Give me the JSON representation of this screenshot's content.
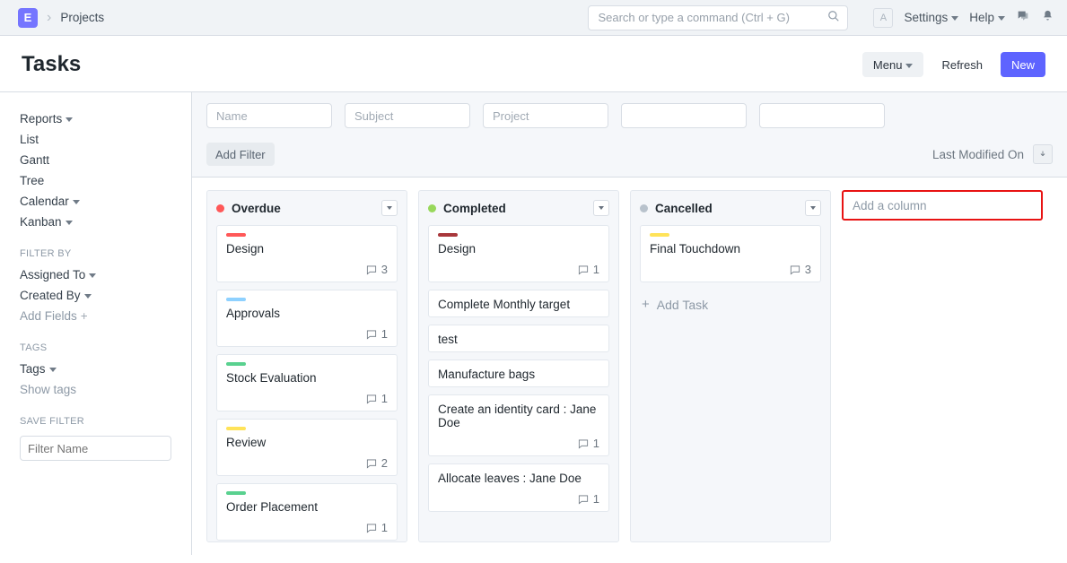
{
  "nav": {
    "logo_letter": "E",
    "breadcrumb": "Projects",
    "search_placeholder": "Search or type a command (Ctrl + G)",
    "avatar_letter": "A",
    "settings_label": "Settings",
    "help_label": "Help"
  },
  "page": {
    "title": "Tasks",
    "menu_btn": "Menu",
    "refresh_btn": "Refresh",
    "new_btn": "New"
  },
  "sidebar": {
    "views": [
      {
        "label": "Reports",
        "caret": true
      },
      {
        "label": "List",
        "caret": false
      },
      {
        "label": "Gantt",
        "caret": false
      },
      {
        "label": "Tree",
        "caret": false
      },
      {
        "label": "Calendar",
        "caret": true
      },
      {
        "label": "Kanban",
        "caret": true
      }
    ],
    "filter_by_label": "FILTER BY",
    "filter_by": [
      {
        "label": "Assigned To",
        "caret": true
      },
      {
        "label": "Created By",
        "caret": true
      }
    ],
    "add_fields_label": "Add Fields",
    "tags_label": "TAGS",
    "tags_link": "Tags",
    "show_tags": "Show tags",
    "save_filter_label": "SAVE FILTER",
    "filter_name_placeholder": "Filter Name"
  },
  "filter_bar": {
    "inputs": [
      {
        "placeholder": "Name"
      },
      {
        "placeholder": "Subject"
      },
      {
        "placeholder": "Project"
      },
      {
        "placeholder": ""
      },
      {
        "placeholder": ""
      }
    ],
    "add_filter": "Add Filter",
    "sort_label": "Last Modified On"
  },
  "board": {
    "add_col_label": "Add a column",
    "add_task_label": "Add Task",
    "columns": [
      {
        "title": "Overdue",
        "color": "#ff5858",
        "cards": [
          {
            "title": "Design",
            "bar": "#ff5858",
            "comments": 3
          },
          {
            "title": "Approvals",
            "bar": "#8ed1ff",
            "comments": 1
          },
          {
            "title": "Stock Evaluation",
            "bar": "#59d18f",
            "comments": 1
          },
          {
            "title": "Review",
            "bar": "#ffe359",
            "comments": 2
          },
          {
            "title": "Order Placement",
            "bar": "#59d18f",
            "comments": 1
          }
        ]
      },
      {
        "title": "Completed",
        "color": "#98d85b",
        "cards": [
          {
            "title": "Design",
            "bar": "#a8373b",
            "comments": 1
          },
          {
            "title": "Complete Monthly target",
            "bar": null,
            "comments": null
          },
          {
            "title": "test",
            "bar": null,
            "comments": null
          },
          {
            "title": "Manufacture bags",
            "bar": null,
            "comments": null
          },
          {
            "title": "Create an identity card : Jane Doe",
            "bar": null,
            "comments": 1
          },
          {
            "title": "Allocate leaves : Jane Doe",
            "bar": null,
            "comments": 1
          }
        ]
      },
      {
        "title": "Cancelled",
        "color": "#b8c2cc",
        "cards": [
          {
            "title": "Final Touchdown",
            "bar": "#ffe359",
            "comments": 3
          }
        ],
        "show_add": true
      }
    ]
  }
}
